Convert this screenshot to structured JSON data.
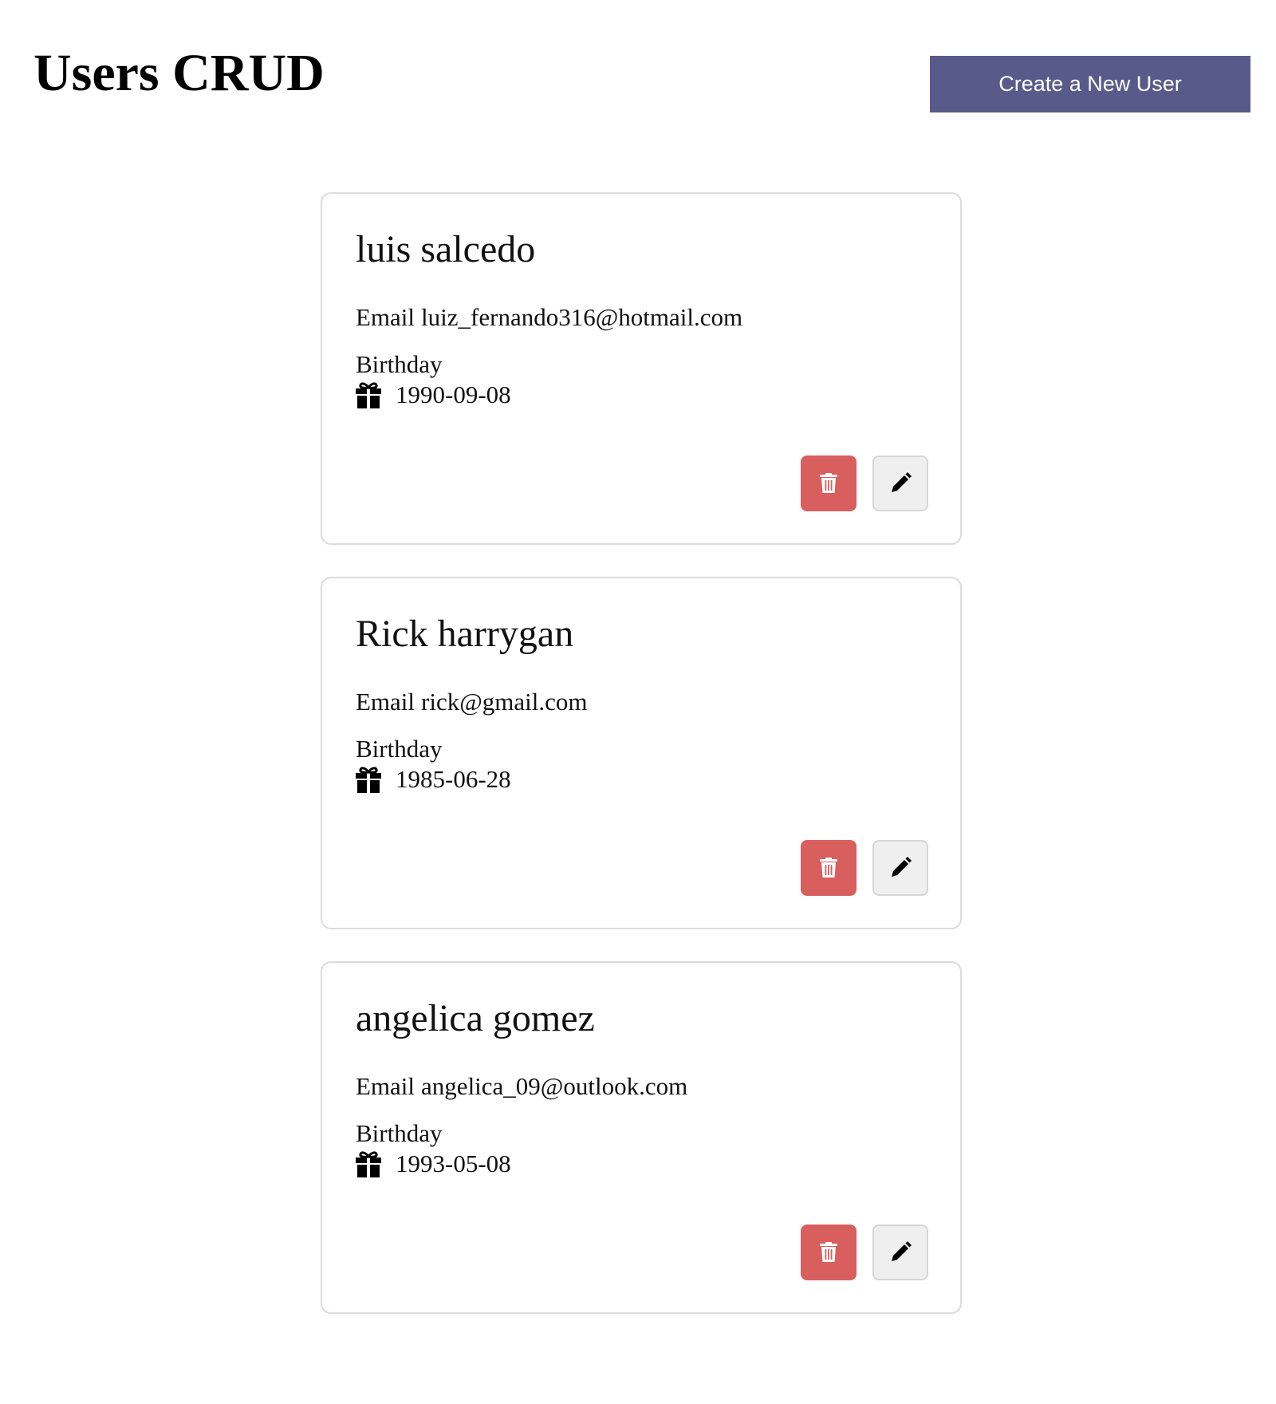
{
  "header": {
    "title": "Users CRUD",
    "create_button_label": "Create a New User"
  },
  "users": [
    {
      "name": "luis salcedo",
      "email_label": "Email",
      "email": "luiz_fernando316@hotmail.com",
      "birthday_label": "Birthday",
      "birthday": "1990-09-08"
    },
    {
      "name": "Rick harrygan",
      "email_label": "Email",
      "email": "rick@gmail.com",
      "birthday_label": "Birthday",
      "birthday": "1985-06-28"
    },
    {
      "name": "angelica gomez",
      "email_label": "Email",
      "email": "angelica_09@outlook.com",
      "birthday_label": "Birthday",
      "birthday": "1993-05-08"
    }
  ],
  "icons": {
    "birthday": "gift-icon",
    "delete": "trash-icon",
    "edit": "pencil-icon"
  },
  "colors": {
    "primary": "#585b89",
    "danger": "#d95e5e",
    "neutral_button": "#efefef",
    "card_border": "#dcdcdc"
  }
}
